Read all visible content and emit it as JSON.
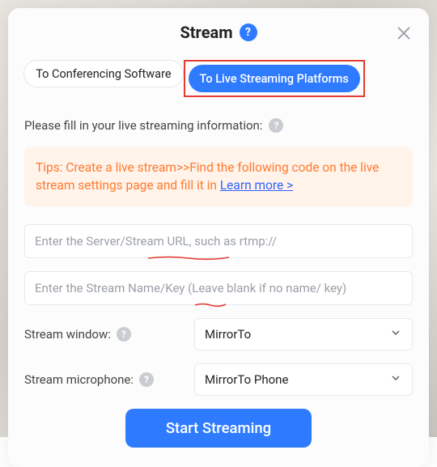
{
  "header": {
    "title": "Stream"
  },
  "tabs": {
    "conferencing": "To Conferencing Software",
    "live": "To Live Streaming Platforms"
  },
  "instruction": "Please fill in your live streaming information:",
  "tips": {
    "text": "Tips: Create a live stream>>Find the following code on the live stream settings page and fill it in ",
    "link": "Learn more >"
  },
  "fields": {
    "server_placeholder": "Enter the Server/Stream URL, such as rtmp://",
    "key_placeholder": "Enter the Stream Name/Key (Leave blank if no name/ key)"
  },
  "window_row": {
    "label": "Stream window:",
    "value": "MirrorTo"
  },
  "mic_row": {
    "label": "Stream microphone:",
    "value": "MirrorTo Phone"
  },
  "cta": "Start Streaming",
  "icons": {
    "help": "?",
    "close": "×"
  }
}
